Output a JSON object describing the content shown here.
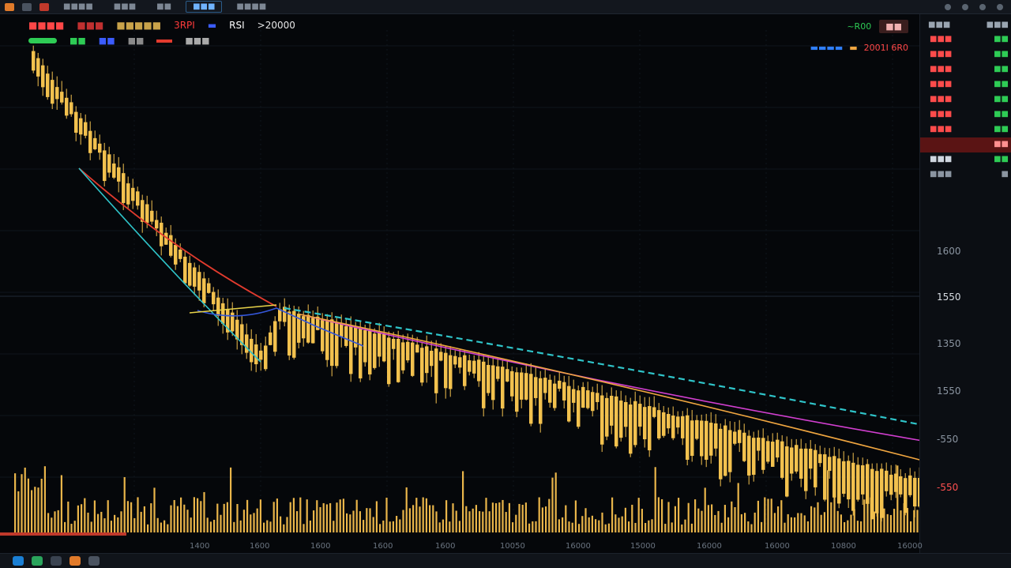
{
  "legend": {
    "rsi": "RSI",
    "value": ">20000",
    "red_code": "3RPI",
    "right_label": "~R00",
    "right_series": "2001I 6R0"
  },
  "colors": {
    "candle": "#f2c14e",
    "volume": "#e9b54a",
    "ma_red": "#e23b2e",
    "ma_cyan": "#2fc4c9",
    "ma_blue": "#3456d8",
    "ma_magenta": "#d23fd0",
    "ma_orange": "#f0a640",
    "background": "#05070a"
  },
  "right_axis": {
    "labels": [
      "1600",
      "1550",
      "1350",
      "1550",
      "-550",
      "-550"
    ],
    "current_price": "1550"
  },
  "x_axis": {
    "labels": [
      "1400",
      "1600",
      "1600",
      "1600",
      "1600",
      "10050",
      "16000",
      "15000",
      "16000",
      "16000",
      "10800",
      "16000"
    ]
  },
  "chart_data": {
    "type": "line",
    "series": [
      {
        "values": [
          1640,
          1590,
          1555,
          1540,
          1525,
          1510,
          1500,
          1485,
          1470,
          1455,
          1440,
          1420,
          1400
        ]
      },
      {
        "values": [
          1640,
          1585,
          1540,
          1535,
          1530,
          1520,
          1505,
          1490,
          1475,
          1460,
          1440,
          1425,
          1410
        ]
      },
      {
        "values": [
          1640,
          1600,
          1560,
          1545,
          1525,
          1505,
          1495,
          1480,
          1460,
          1445,
          1420,
          1400,
          1385
        ]
      }
    ],
    "ylim": [
      1300,
      1700
    ]
  }
}
